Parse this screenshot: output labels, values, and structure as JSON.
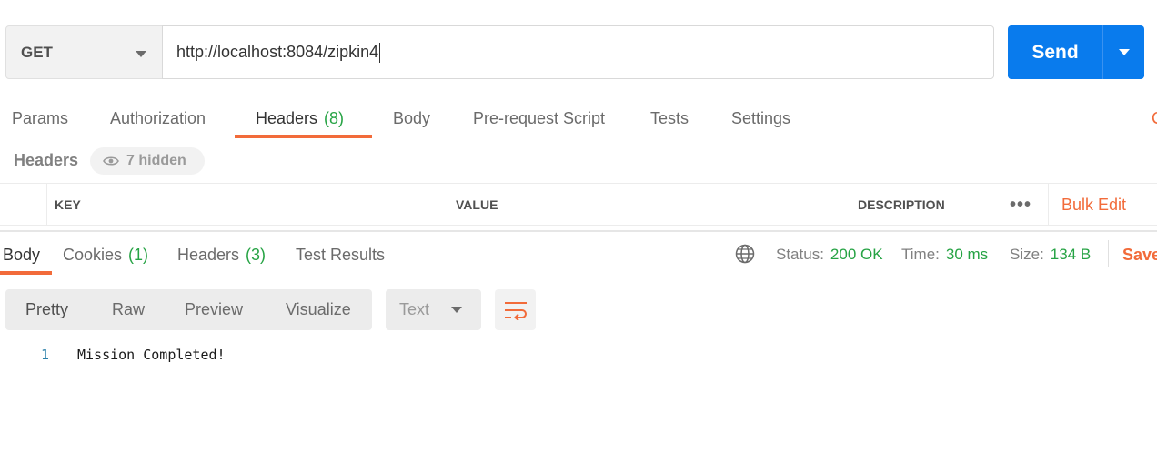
{
  "request": {
    "method": "GET",
    "url": "http://localhost:8084/zipkin4",
    "send_label": "Send"
  },
  "request_tabs": {
    "params": "Params",
    "authorization": "Authorization",
    "headers": "Headers",
    "headers_count": "(8)",
    "body": "Body",
    "prerequest": "Pre-request Script",
    "tests": "Tests",
    "settings": "Settings",
    "edge_mark": "C"
  },
  "headers_section": {
    "title": "Headers",
    "hidden_label": "7 hidden",
    "columns": {
      "key": "KEY",
      "value": "VALUE",
      "description": "DESCRIPTION"
    },
    "more": "•••",
    "bulk_edit": "Bulk Edit"
  },
  "response_tabs": {
    "body": "Body",
    "cookies": "Cookies",
    "cookies_count": "(1)",
    "headers": "Headers",
    "headers_count": "(3)",
    "test_results": "Test Results"
  },
  "response_meta": {
    "status_label": "Status:",
    "status_value": "200 OK",
    "time_label": "Time:",
    "time_value": "30 ms",
    "size_label": "Size:",
    "size_value": "134 B",
    "save_label": "Save"
  },
  "format_bar": {
    "pretty": "Pretty",
    "raw": "Raw",
    "preview": "Preview",
    "visualize": "Visualize",
    "type": "Text"
  },
  "response_body": {
    "lines": [
      {
        "no": "1",
        "text": "Mission Completed!"
      }
    ]
  },
  "colors": {
    "accent": "#f26b3a",
    "send": "#097bed",
    "success": "#26a344"
  }
}
